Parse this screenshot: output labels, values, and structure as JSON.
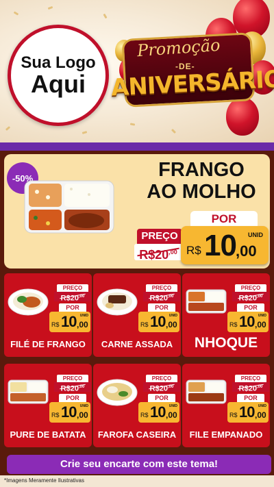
{
  "logo": {
    "line1": "Sua Logo",
    "line2": "Aqui"
  },
  "promo": {
    "top": "Promoção",
    "de": "-DE-",
    "main": "ANIVERSÁRIO"
  },
  "featured": {
    "discount": "-50%",
    "title_line1": "FRANGO",
    "title_line2": "AO MOLHO",
    "preco_label": "PREÇO",
    "old_price_main": "R$20",
    "old_price_cents": ",00",
    "por_label": "POR",
    "currency": "R$",
    "new_price_main": "10",
    "new_price_cents": ",00",
    "unid": "UNID"
  },
  "cards": [
    {
      "name": "FILÉ DE FRANGO",
      "preco_label": "PREÇO",
      "old_main": "R$20",
      "old_cents": ",00",
      "por_label": "POR",
      "currency": "R$",
      "new_main": "10",
      "new_cents": ",00",
      "unid": "UNID"
    },
    {
      "name": "CARNE ASSADA",
      "preco_label": "PREÇO",
      "old_main": "R$20",
      "old_cents": ",00",
      "por_label": "POR",
      "currency": "R$",
      "new_main": "10",
      "new_cents": ",00",
      "unid": "UNID"
    },
    {
      "name": "NHOQUE",
      "preco_label": "PREÇO",
      "old_main": "R$20",
      "old_cents": ",00",
      "por_label": "POR",
      "currency": "R$",
      "new_main": "10",
      "new_cents": ",00",
      "unid": "UNID"
    },
    {
      "name": "PURE DE BATATA",
      "preco_label": "PREÇO",
      "old_main": "R$20",
      "old_cents": ",00",
      "por_label": "POR",
      "currency": "R$",
      "new_main": "10",
      "new_cents": ",00",
      "unid": "UNID"
    },
    {
      "name": "FAROFA CASEIRA",
      "preco_label": "PREÇO",
      "old_main": "R$20",
      "old_cents": ",00",
      "por_label": "POR",
      "currency": "R$",
      "new_main": "10",
      "new_cents": ",00",
      "unid": "UNID"
    },
    {
      "name": "FILE EMPANADO",
      "preco_label": "PREÇO",
      "old_main": "R$20",
      "old_cents": ",00",
      "por_label": "POR",
      "currency": "R$",
      "new_main": "10",
      "new_cents": ",00",
      "unid": "UNID"
    }
  ],
  "cta": "Crie seu encarte com este tema!",
  "footer_note": "*Imagens Meramente Ilustrativas",
  "colors": {
    "red": "#c80f1c",
    "purple": "#8b2bb6",
    "yellow": "#f7b731",
    "cream": "#fae1a8",
    "brown": "#5a1a0c"
  }
}
